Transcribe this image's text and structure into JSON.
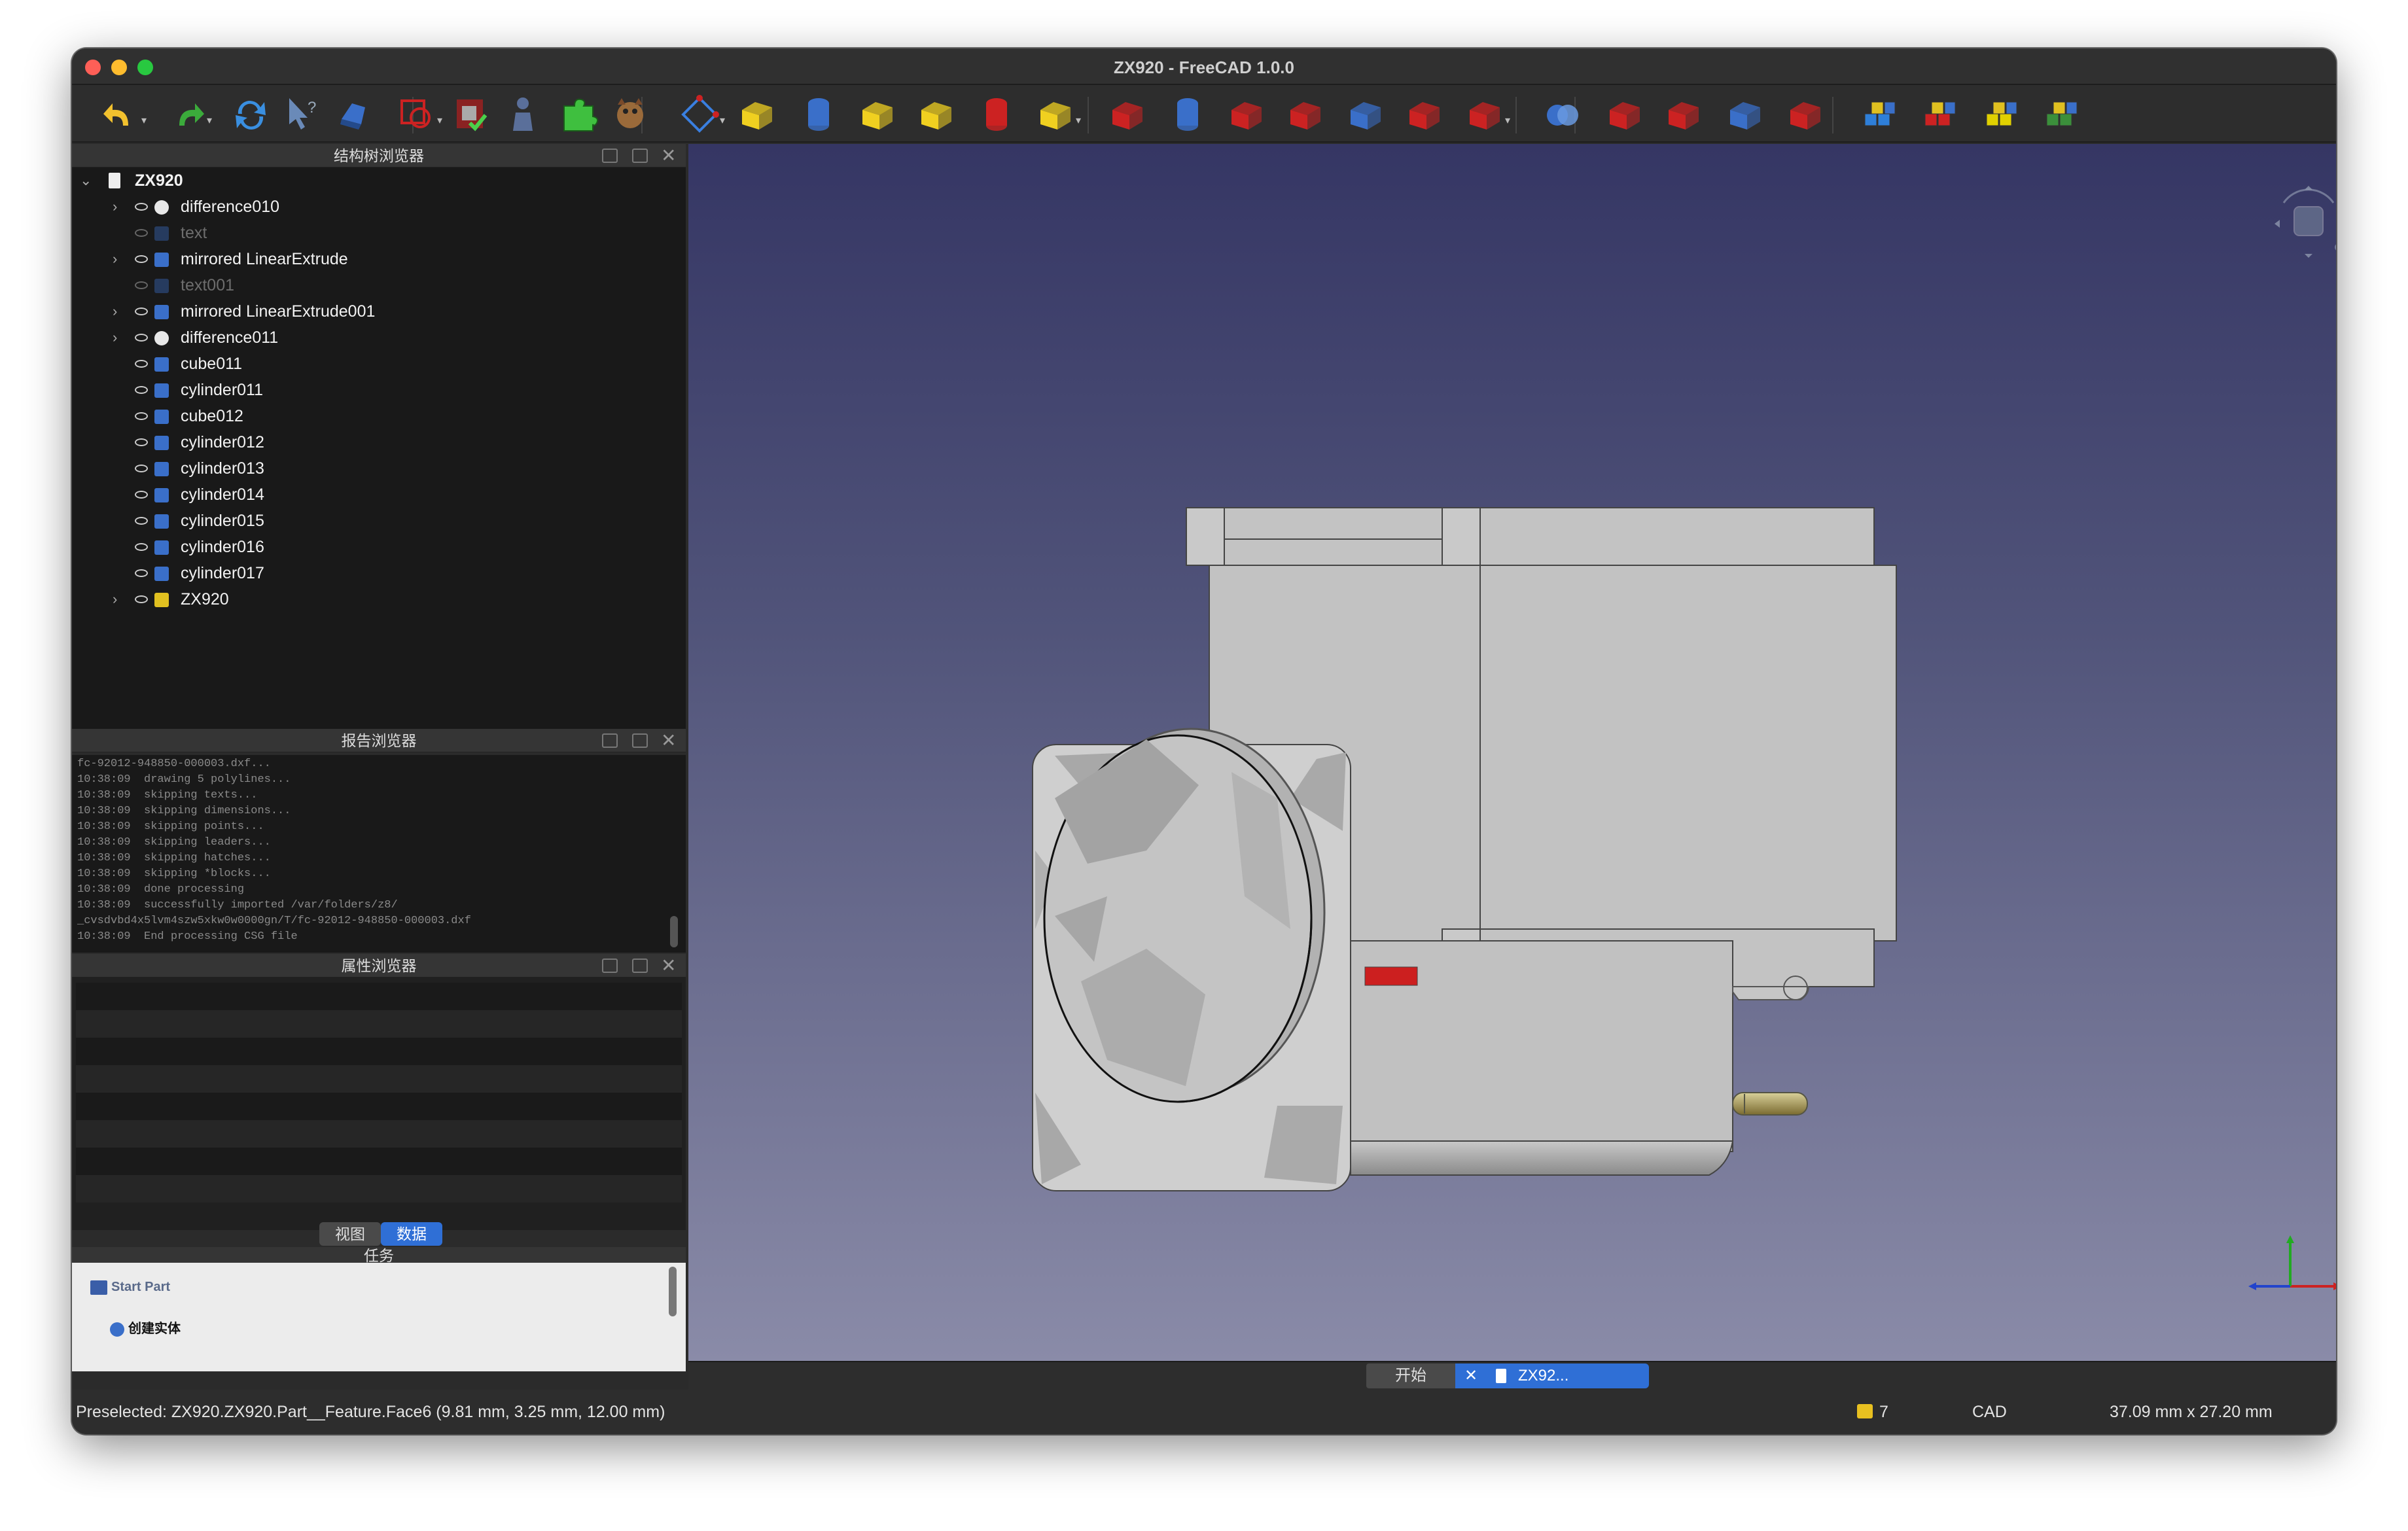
{
  "window": {
    "title": "ZX920 - FreeCAD 1.0.0"
  },
  "toolbar": {
    "buttons": [
      {
        "name": "undo-icon",
        "dropdown": true
      },
      {
        "name": "redo-icon",
        "dropdown": true
      },
      {
        "name": "refresh-icon"
      },
      {
        "name": "whats-this-icon"
      },
      {
        "name": "std-part-icon"
      },
      {
        "name": "link-make-icon",
        "dropdown": true
      },
      {
        "name": "validate-icon"
      },
      {
        "name": "person-icon"
      },
      {
        "name": "puzzle-icon"
      },
      {
        "name": "openscad-icon"
      },
      {
        "name": "sketch-icon",
        "dropdown": true
      },
      {
        "name": "extrude-icon"
      },
      {
        "name": "revolve-icon"
      },
      {
        "name": "mirror-icon"
      },
      {
        "name": "fillet-icon"
      },
      {
        "name": "chamfer-icon"
      },
      {
        "name": "primitives-icon",
        "dropdown": true
      },
      {
        "name": "compound-icon"
      },
      {
        "name": "shape-builder-icon"
      },
      {
        "name": "loft-icon"
      },
      {
        "name": "sweep-icon"
      },
      {
        "name": "section-icon"
      },
      {
        "name": "cross-section-icon"
      },
      {
        "name": "cut-icon",
        "dropdown": true
      },
      {
        "name": "boolean-icon"
      },
      {
        "name": "offset-icon"
      },
      {
        "name": "thickness-icon"
      },
      {
        "name": "projection-icon"
      },
      {
        "name": "face-maker-icon"
      },
      {
        "name": "attachment-icon"
      },
      {
        "name": "ruled-surface-icon"
      },
      {
        "name": "refine-icon"
      },
      {
        "name": "check-geometry-icon"
      }
    ]
  },
  "tree": {
    "title": "结构树浏览器",
    "rows": [
      {
        "label": "ZX920",
        "expanded": true,
        "root": true
      },
      {
        "label": "difference010",
        "expandable": true,
        "icon": "difference"
      },
      {
        "label": "text",
        "hidden": true,
        "icon": "text"
      },
      {
        "label": "mirrored LinearExtrude",
        "expandable": true,
        "icon": "mirror"
      },
      {
        "label": "text001",
        "hidden": true,
        "icon": "text"
      },
      {
        "label": "mirrored LinearExtrude001",
        "expandable": true,
        "icon": "mirror"
      },
      {
        "label": "difference011",
        "expandable": true,
        "icon": "difference"
      },
      {
        "label": "cube011",
        "icon": "cube"
      },
      {
        "label": "cylinder011",
        "icon": "cylinder"
      },
      {
        "label": "cube012",
        "icon": "cube"
      },
      {
        "label": "cylinder012",
        "icon": "cylinder"
      },
      {
        "label": "cylinder013",
        "icon": "cylinder"
      },
      {
        "label": "cylinder014",
        "icon": "cylinder"
      },
      {
        "label": "cylinder015",
        "icon": "cylinder"
      },
      {
        "label": "cylinder016",
        "icon": "cylinder"
      },
      {
        "label": "cylinder017",
        "icon": "cylinder"
      },
      {
        "label": "ZX920",
        "expandable": true,
        "icon": "part"
      }
    ]
  },
  "report": {
    "title": "报告浏览器",
    "lines": [
      "fc-92012-948850-000003.dxf...",
      "10:38:09  drawing 5 polylines...",
      "10:38:09  skipping texts...",
      "10:38:09  skipping dimensions...",
      "10:38:09  skipping points...",
      "10:38:09  skipping leaders...",
      "10:38:09  skipping hatches...",
      "10:38:09  skipping *blocks...",
      "10:38:09  done processing",
      "10:38:09  successfully imported /var/folders/z8/",
      "_cvsdvbd4x5lvm4szw5xkw0w0000gn/T/fc-92012-948850-000003.dxf",
      "10:38:09  End processing CSG file"
    ]
  },
  "properties": {
    "title": "属性浏览器",
    "tabs": [
      {
        "label": "视图",
        "active": false
      },
      {
        "label": "数据",
        "active": true
      }
    ]
  },
  "tasks": {
    "title": "任务",
    "items": [
      {
        "label": "Start Part",
        "icon": "part-icon"
      },
      {
        "label": "创建实体",
        "icon": "create-solid-icon"
      }
    ]
  },
  "doc_tabs": [
    {
      "label": "开始",
      "active": false
    },
    {
      "label": "ZX92...",
      "active": true
    }
  ],
  "status": {
    "preselected": "Preselected: ZX920.ZX920.Part__Feature.Face6 (9.81 mm, 3.25 mm, 12.00 mm)",
    "notifications": "7",
    "nav_style": "CAD",
    "dimensions": "37.09 mm x 27.20 mm"
  },
  "colors": {
    "accent": "#2f6fd6",
    "selection": "#cc1f1f",
    "model": "#c0c0c0"
  }
}
